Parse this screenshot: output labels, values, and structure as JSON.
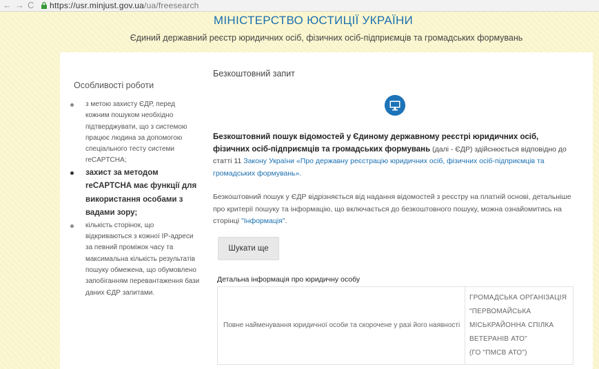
{
  "browser": {
    "url_host": "https://usr.minjust.gov.ua",
    "url_path": "/ua/freesearch"
  },
  "header": {
    "title": "МІНІСТЕРСТВО ЮСТИЦІЇ УКРАЇНИ",
    "subtitle": "Єдиний державний реєстр юридичних осіб, фізичних осіб-підприємців та громадських формувань"
  },
  "sidebar": {
    "title": "Особливості роботи",
    "items": [
      "з метою захисту ЄДР, перед кожним пошуком необхідно підтверджувати, що з системою працює людина за допомогою спеціального тесту системи reCAPTCHA;",
      "захист за методом reCAPTCHA має функції для використання особами з вадами зору;",
      "кількість сторінок, що відкриваються з кожної IP-адреси за певний проміжок часу та максимальна кількість результатів пошуку обмежена, що обумовлено запобіганням перевантаження бази даних ЄДР запитами."
    ]
  },
  "main": {
    "title": "Безкоштовний запит",
    "icon": "monitor-icon",
    "intro_bold": "Безкоштовний пошук відомостей у Єдиному державному реєстрі юридичних осіб, фізичних осіб-підприємців та громадських формувань",
    "intro_rest": " (далі - ЄДР) здійснюється відповідно до статті 11",
    "intro_link": "Закону України «Про державну реєстрацію юридичних осіб, фізичних осіб-підприємців та громадських формувань».",
    "para2_text": "Безкоштовний пошук у ЄДР відрізняється від надання відомостей з реєстру на платній основі, детальніше про критерії пошуку та інформацію, що включається до безкоштовного пошуку, можна ознайомитись на сторінці ",
    "para2_link": "\"Інформація\"",
    "para2_end": ".",
    "search_button": "Шукати ще",
    "detail_title": "Детальна інформація про юридичну особу",
    "detail_rows": [
      {
        "key": "Повне найменування юридичної особи та скорочене у разі його наявності",
        "value_lines": [
          "ГРОМАДСЬКА ОРГАНІЗАЦІЯ",
          "\"ПЕРВОМАЙСЬКА",
          "МІСЬКРАЙОННА СПІЛКА",
          "ВЕТЕРАНІВ АТО\"",
          "(ГО \"ПМСВ АТО\")"
        ]
      }
    ]
  }
}
